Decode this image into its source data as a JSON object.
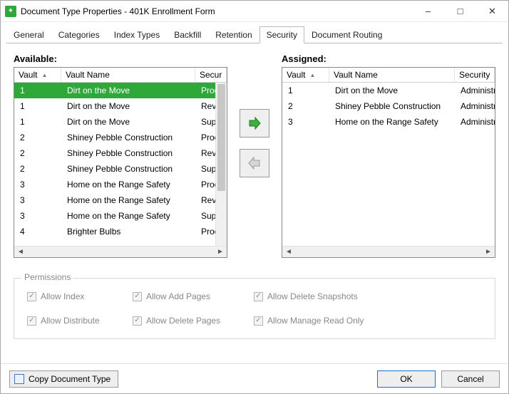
{
  "window": {
    "title": "Document Type Properties  - 401K Enrollment Form"
  },
  "tabs": [
    "General",
    "Categories",
    "Index Types",
    "Backfill",
    "Retention",
    "Security",
    "Document Routing"
  ],
  "active_tab": "Security",
  "available": {
    "title": "Available:",
    "columns": {
      "vault": "Vault",
      "name": "Vault Name",
      "security": "Secur"
    },
    "rows": [
      {
        "vault": "1",
        "name": "Dirt on the Move",
        "security": "Proces",
        "selected": true
      },
      {
        "vault": "1",
        "name": "Dirt on the Move",
        "security": "Review"
      },
      {
        "vault": "1",
        "name": "Dirt on the Move",
        "security": "Superv"
      },
      {
        "vault": "2",
        "name": "Shiney Pebble Construction",
        "security": "Proces"
      },
      {
        "vault": "2",
        "name": "Shiney Pebble Construction",
        "security": "Review"
      },
      {
        "vault": "2",
        "name": "Shiney Pebble Construction",
        "security": "Superv"
      },
      {
        "vault": "3",
        "name": "Home on the Range Safety",
        "security": "Proces"
      },
      {
        "vault": "3",
        "name": "Home on the Range Safety",
        "security": "Review"
      },
      {
        "vault": "3",
        "name": "Home on the Range Safety",
        "security": "Superv"
      },
      {
        "vault": "4",
        "name": "Brighter Bulbs",
        "security": "Proces"
      }
    ]
  },
  "assigned": {
    "title": "Assigned:",
    "columns": {
      "vault": "Vault",
      "name": "Vault Name",
      "security": "Security"
    },
    "rows": [
      {
        "vault": "1",
        "name": "Dirt on the Move",
        "security": "Administra"
      },
      {
        "vault": "2",
        "name": "Shiney Pebble Construction",
        "security": "Administra"
      },
      {
        "vault": "3",
        "name": "Home on the Range Safety",
        "security": "Administra"
      }
    ]
  },
  "permissions": {
    "legend": "Permissions",
    "items": {
      "allow_index": "Allow Index",
      "allow_add_pages": "Allow Add Pages",
      "allow_delete_snapshots": "Allow Delete Snapshots",
      "allow_distribute": "Allow Distribute",
      "allow_delete_pages": "Allow Delete Pages",
      "allow_manage_read_only": "Allow Manage Read Only"
    }
  },
  "footer": {
    "copy": "Copy Document Type",
    "ok": "OK",
    "cancel": "Cancel"
  }
}
